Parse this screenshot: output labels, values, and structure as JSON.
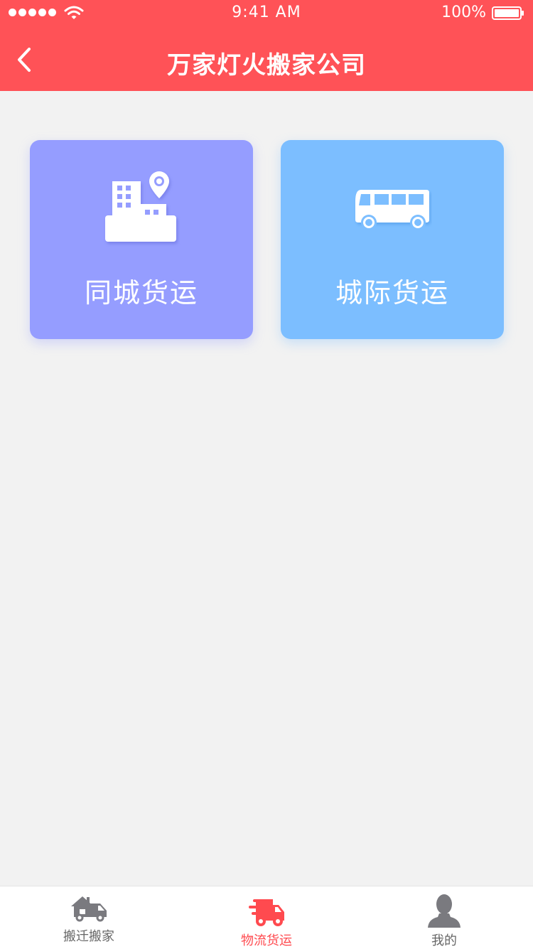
{
  "status_bar": {
    "time": "9:41 AM",
    "battery": "100%"
  },
  "nav": {
    "title": "万家灯火搬家公司"
  },
  "cards": [
    {
      "label": "同城货运",
      "icon": "city-building-location-icon",
      "color": "#959dff"
    },
    {
      "label": "城际货运",
      "icon": "bus-icon",
      "color": "#7cbeff"
    }
  ],
  "tabs": [
    {
      "label": "搬迁搬家",
      "icon": "moving-truck-house-icon",
      "active": false
    },
    {
      "label": "物流货运",
      "icon": "delivery-truck-icon",
      "active": true
    },
    {
      "label": "我的",
      "icon": "user-icon",
      "active": false
    }
  ],
  "colors": {
    "header": "#ff5257",
    "active_tab": "#ff4a4f",
    "inactive_tab": "#666666"
  }
}
